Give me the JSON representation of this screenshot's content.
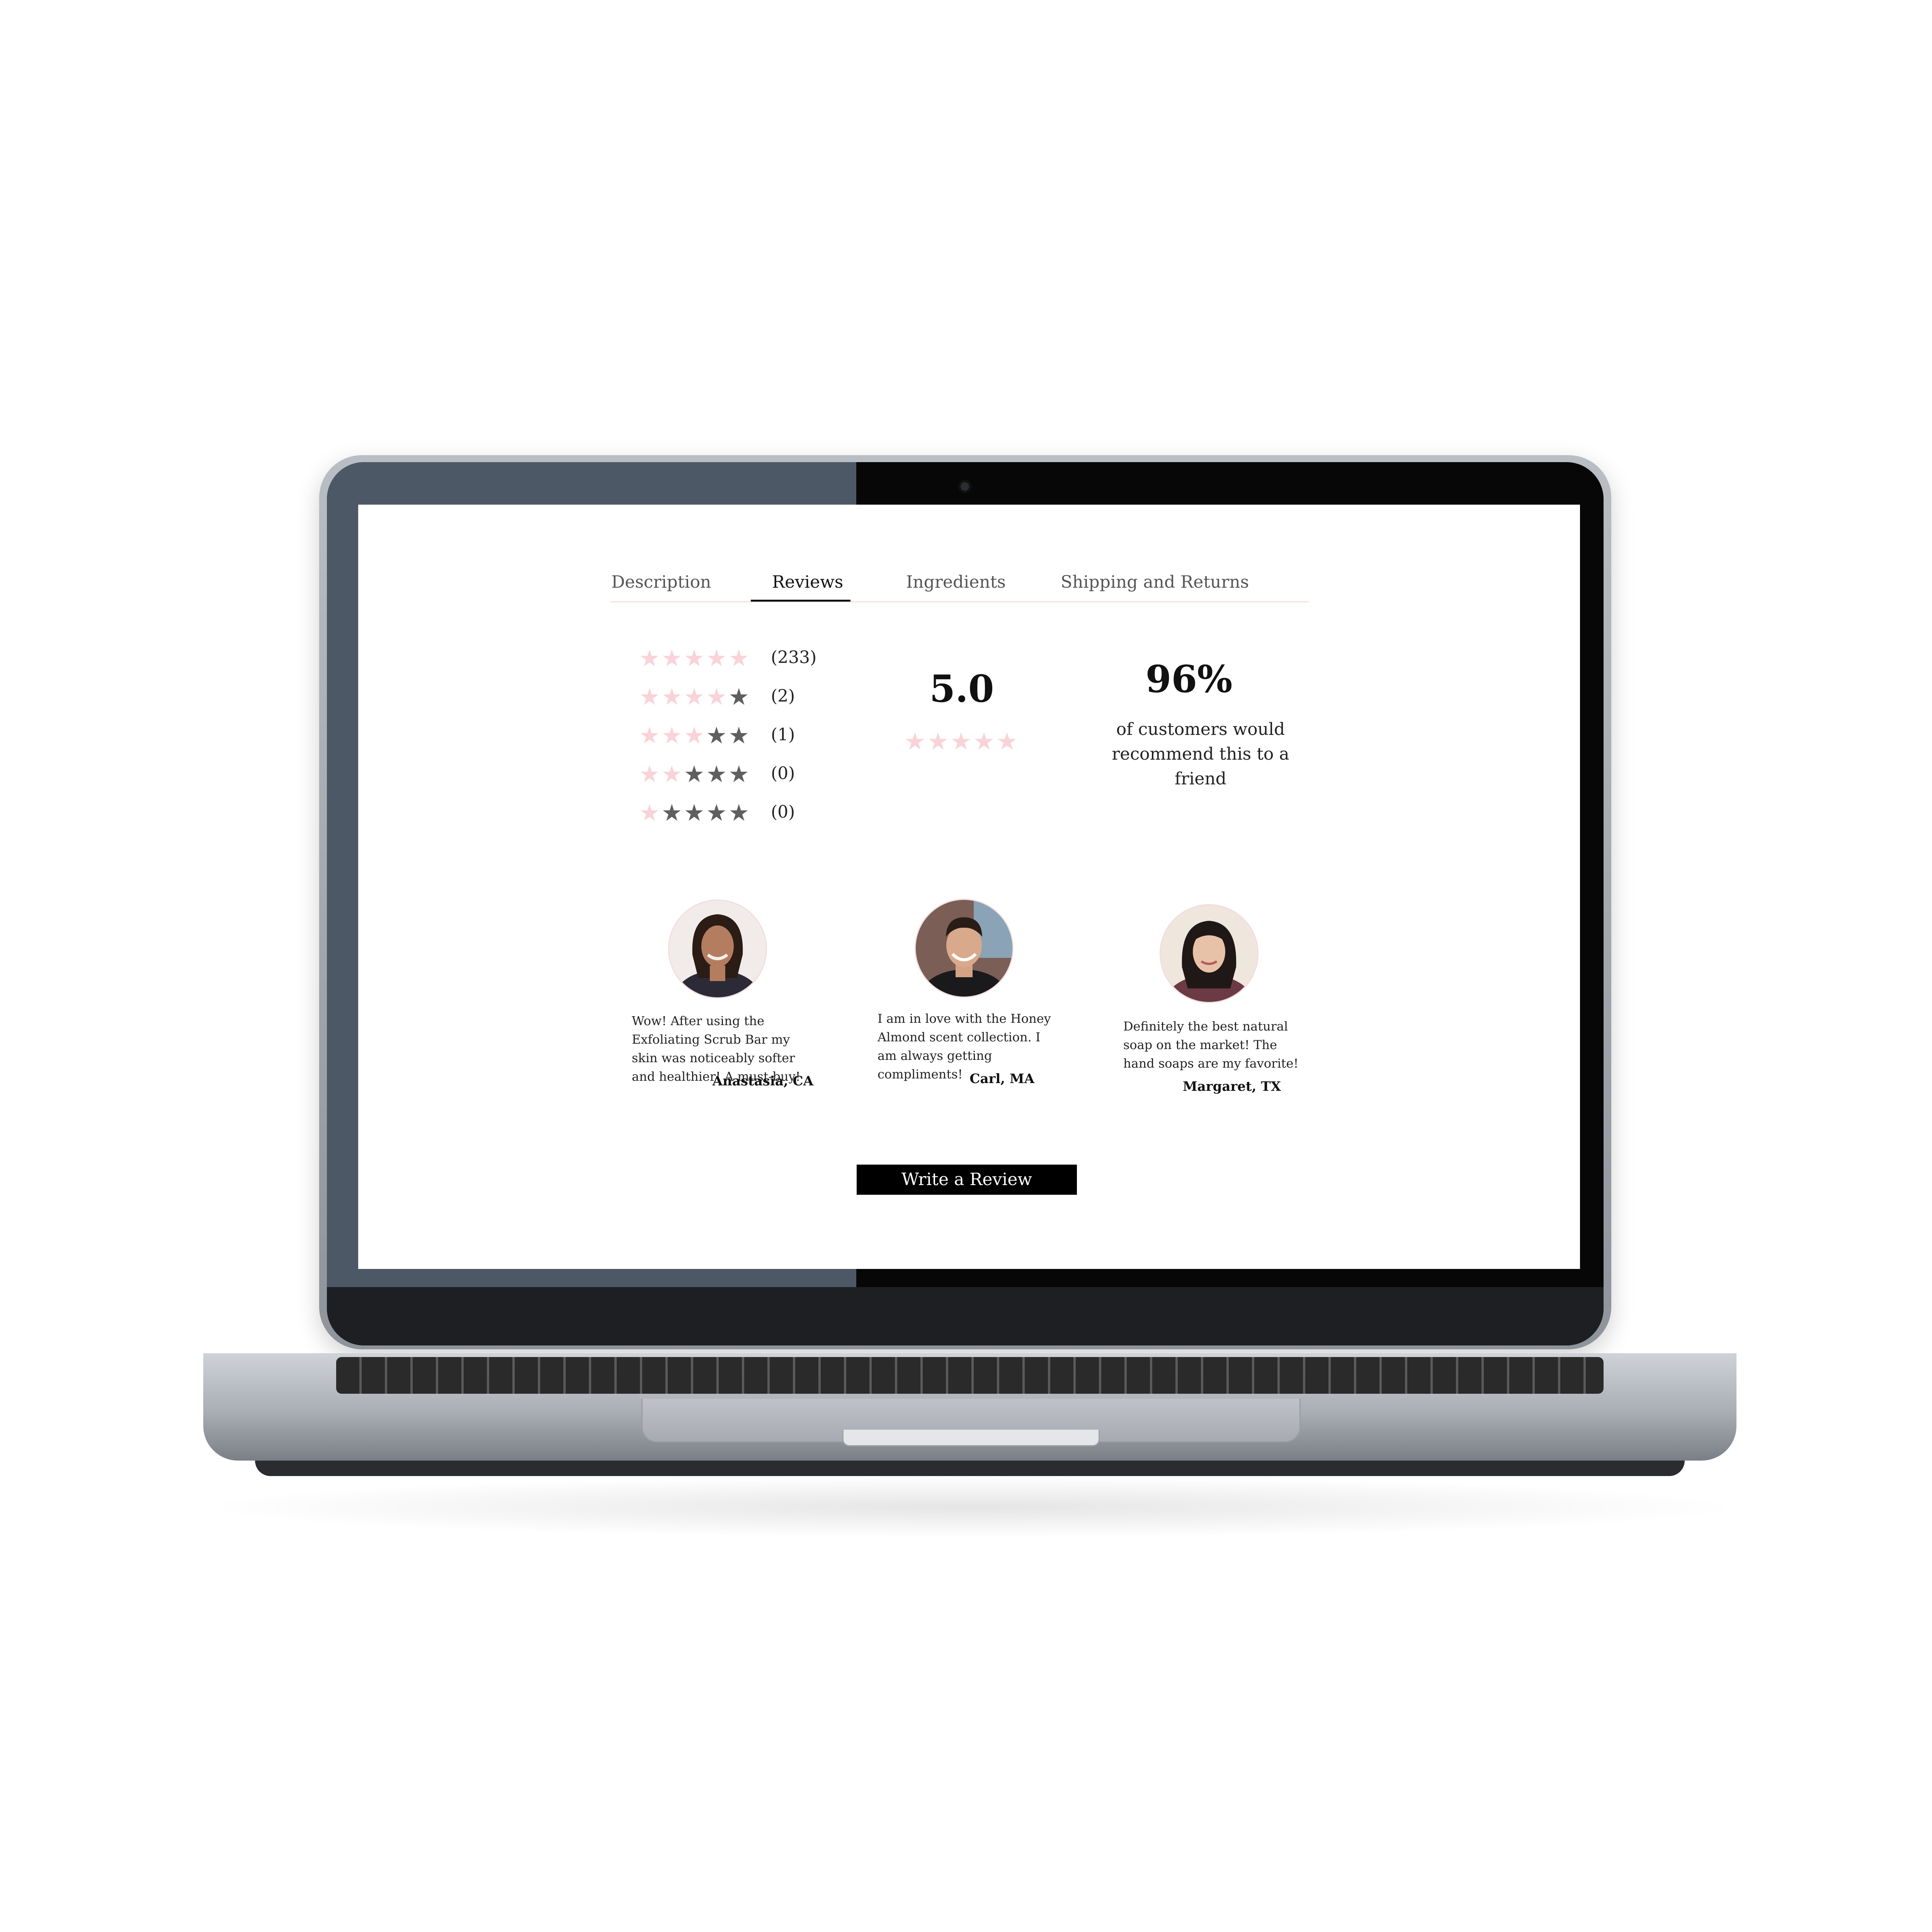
{
  "tabs": [
    {
      "label": "Description"
    },
    {
      "label": "Reviews",
      "active": true
    },
    {
      "label": "Ingredients"
    },
    {
      "label": "Shipping and Returns"
    }
  ],
  "rating_breakdown": [
    {
      "stars": 5,
      "count": "(233)"
    },
    {
      "stars": 4,
      "count": "(2)"
    },
    {
      "stars": 3,
      "count": "(1)"
    },
    {
      "stars": 2,
      "count": "(0)"
    },
    {
      "stars": 1,
      "count": "(0)"
    }
  ],
  "average": {
    "value": "5.0",
    "stars": 5
  },
  "recommend": {
    "percent": "96%",
    "caption_line1": "of customers would",
    "caption_line2": "recommend this to a friend"
  },
  "reviews": [
    {
      "text": "Wow! After using the Exfoliating Scrub Bar my skin was noticeably softer and healthier! A must-buy!",
      "author": "Anastasia, CA"
    },
    {
      "text": "I am in love with the Honey Almond scent collection. I am always getting compliments!",
      "author": "Carl, MA"
    },
    {
      "text": "Definitely the best natural soap on the market! The hand soaps are my favorite!",
      "author": "Margaret, TX"
    }
  ],
  "write_review_label": "Write a Review",
  "colors": {
    "star_filled": "#f9d3d8",
    "star_empty": "#5f5f5f",
    "button_bg": "#000000",
    "bezel_left": "#4d5867"
  },
  "icons": {
    "star": "star-icon"
  }
}
